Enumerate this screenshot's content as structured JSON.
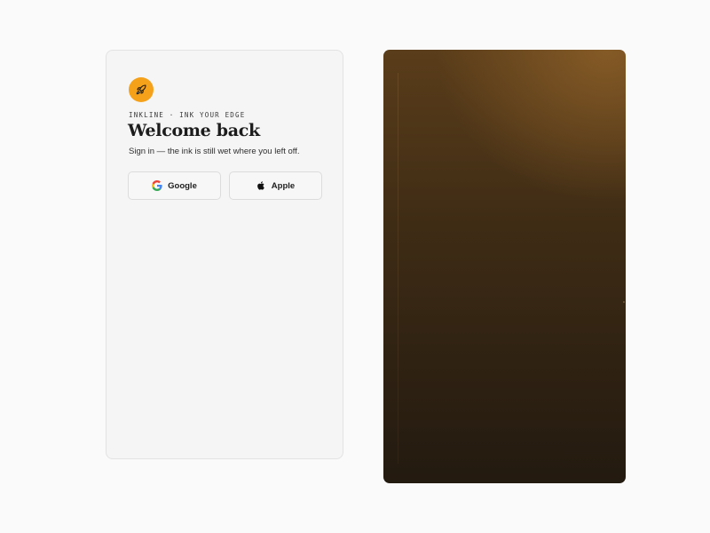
{
  "brand": {
    "eyebrow": "INKLINE · INK YOUR EDGE",
    "logo_icon": "rocket-icon",
    "accent_color": "#f5a11a"
  },
  "login": {
    "title": "Welcome back",
    "subtitle": "Sign in — the ink is still wet where you left off.",
    "buttons": [
      {
        "label": "Google",
        "icon": "google-icon"
      },
      {
        "label": "Apple",
        "icon": "apple-icon"
      }
    ]
  },
  "hero": {
    "colors": [
      "#5a3d1a",
      "#3f2c15",
      "#231a10"
    ]
  }
}
